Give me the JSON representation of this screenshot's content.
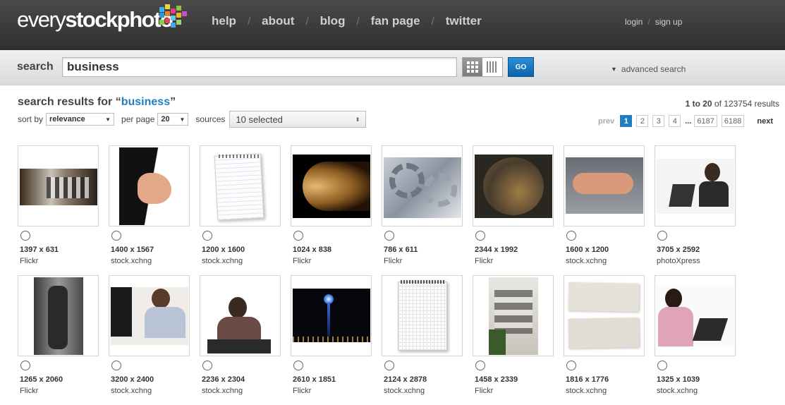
{
  "header": {
    "logo_light": "every",
    "logo_bold": "stockphoto",
    "nav": [
      "help",
      "about",
      "blog",
      "fan page",
      "twitter"
    ],
    "login": "login",
    "signup": "sign up"
  },
  "search": {
    "label": "search",
    "query": "business",
    "go_label": "GO",
    "advanced_label": "advanced search"
  },
  "results": {
    "title_prefix": "search results for ",
    "quote_open": "“",
    "query": "business",
    "quote_close": "”",
    "count_range": "1 to 20",
    "count_of": " of 123754 results",
    "sort_label": "sort by",
    "sort_value": "relevance",
    "perpage_label": "per page",
    "perpage_value": "20",
    "sources_label": "sources",
    "sources_value": "10 selected"
  },
  "pager": {
    "prev": "prev",
    "pages": [
      "1",
      "2",
      "3",
      "4"
    ],
    "dots": "...",
    "last_pages": [
      "6187",
      "6188"
    ],
    "next": "next",
    "current": "1"
  },
  "colors": {
    "accent": "#1f7ec2",
    "header_bg": "#3a3a3a",
    "go_button": "#1a73c0"
  },
  "items": [
    {
      "dims": "1397 x 631",
      "source": "Flickr",
      "license": "person-icon"
    },
    {
      "dims": "1400 x 1567",
      "source": "stock.xchng",
      "license": "clock-icon"
    },
    {
      "dims": "1200 x 1600",
      "source": "stock.xchng",
      "license": "clock-icon"
    },
    {
      "dims": "1024 x 838",
      "source": "Flickr",
      "license": "person-icon"
    },
    {
      "dims": "786 x 611",
      "source": "Flickr",
      "license": "person-icon"
    },
    {
      "dims": "2344 x 1992",
      "source": "Flickr",
      "license": "person-icon"
    },
    {
      "dims": "1600 x 1200",
      "source": "stock.xchng",
      "license": "clock-icon"
    },
    {
      "dims": "3705 x 2592",
      "source": "photoXpress",
      "license": "clock-icon"
    },
    {
      "dims": "1265 x 2060",
      "source": "Flickr",
      "license": "person-icon"
    },
    {
      "dims": "3200 x 2400",
      "source": "stock.xchng",
      "license": "clock-icon"
    },
    {
      "dims": "2236 x 2304",
      "source": "stock.xchng",
      "license": "clock-icon"
    },
    {
      "dims": "2610 x 1851",
      "source": "Flickr",
      "license": "person-icon"
    },
    {
      "dims": "2124 x 2878",
      "source": "stock.xchng",
      "license": "clock-icon"
    },
    {
      "dims": "1458 x 2339",
      "source": "Flickr",
      "license": "person-icon"
    },
    {
      "dims": "1816 x 1776",
      "source": "stock.xchng",
      "license": "clock-icon"
    },
    {
      "dims": "1325 x 1039",
      "source": "stock.xchng",
      "license": "clock-icon"
    }
  ]
}
